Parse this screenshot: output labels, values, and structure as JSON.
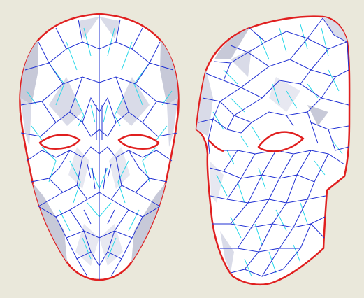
{
  "viewport": {
    "background_color": "#eae8db"
  },
  "colors": {
    "face_fill": "#ffffff",
    "shade_dark": "#c7c9d8",
    "shade_mid": "#d9dbe8",
    "shade_light": "#e7e8f1",
    "eye_fill": "#ffffff",
    "fold_mountain": "#1f2fd3",
    "fold_valley": "#28d7e8",
    "cut_edge": "#e01f1f"
  },
  "models": [
    {
      "id": "front-view",
      "view": "front",
      "icon": "mask-front-icon"
    },
    {
      "id": "side-view",
      "view": "three-quarter",
      "icon": "mask-side-icon"
    }
  ]
}
